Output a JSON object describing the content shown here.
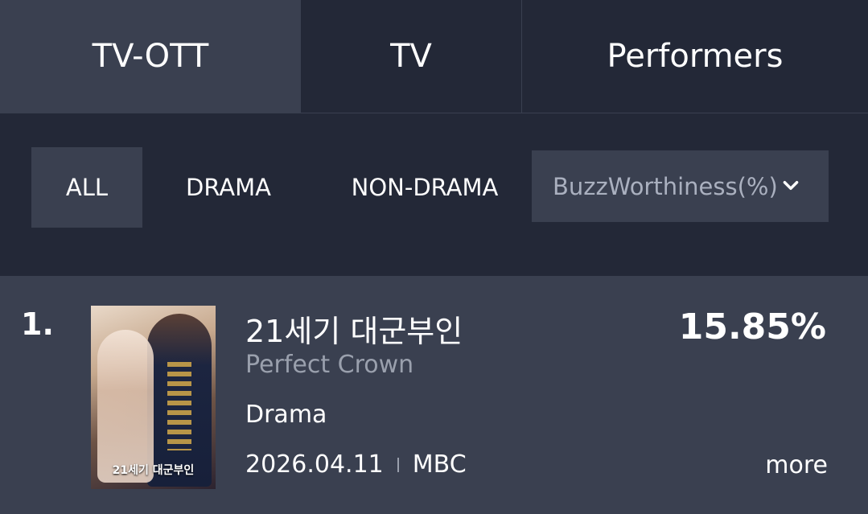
{
  "tabs": [
    "TV-OTT",
    "TV",
    "Performers"
  ],
  "filters": [
    "ALL",
    "DRAMA",
    "NON-DRAMA"
  ],
  "sort_select": {
    "value": "BuzzWorthiness(%)"
  },
  "items": [
    {
      "rank": "1.",
      "poster_text": "21세기 대군부인",
      "title_ko": "21세기 대군부인",
      "title_en": "Perfect Crown",
      "genre": "Drama",
      "date": "2026.04.11",
      "network": "MBC",
      "score": "15.85%",
      "more_label": "more"
    }
  ]
}
